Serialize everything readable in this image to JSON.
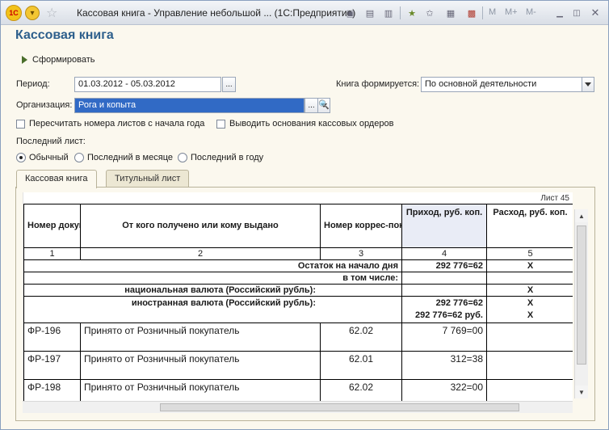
{
  "window": {
    "title": "Кассовая книга - Управление небольшой ... (1С:Предприятие)",
    "logo_text": "1C",
    "toolbar_m": [
      "M",
      "M+",
      "M-"
    ]
  },
  "page": {
    "heading": "Кассовая книга",
    "generate_label": "Сформировать"
  },
  "form": {
    "period_label": "Период:",
    "period_value": "01.03.2012 - 05.03.2012",
    "book_mode_label": "Книга формируется:",
    "book_mode_value": "По основной деятельности",
    "org_label": "Организация:",
    "org_value": "Рога и копыта",
    "recalc_label": "Пересчитать номера листов с начала года",
    "show_basis_label": "Выводить основания кассовых ордеров",
    "last_sheet_label": "Последний лист:",
    "radio_normal": "Обычный",
    "radio_month": "Последний в месяце",
    "radio_year": "Последний в году",
    "selected_radio": "Обычный"
  },
  "tabs": [
    "Кассовая книга",
    "Титульный лист"
  ],
  "sheet": {
    "page_label": "Лист 45",
    "headers": [
      "Номер документа",
      "От кого получено или кому выдано",
      "Номер коррес-пондирующего счета, субсчета",
      "Приход, руб. коп.",
      "Расход, руб. коп."
    ],
    "col_numbers": [
      "1",
      "2",
      "3",
      "4",
      "5"
    ],
    "opening_label": "Остаток на начало дня",
    "opening_income": "292 776=62",
    "opening_expense": "X",
    "including_label": "в том числе:",
    "national_label": "национальная валюта (Российский рубль):",
    "national_expense": "X",
    "foreign_label": "иностранная валюта (Российский рубль):",
    "foreign_income_1": "292 776=62",
    "foreign_income_2": "292 776=62 руб.",
    "foreign_expense_1": "X",
    "foreign_expense_2": "X",
    "rows": [
      {
        "doc": "ФР-196",
        "party": "Принято от Розничный покупатель",
        "account": "62.02",
        "income": "7 769=00",
        "expense": ""
      },
      {
        "doc": "ФР-197",
        "party": "Принято от Розничный покупатель",
        "account": "62.01",
        "income": "312=38",
        "expense": ""
      },
      {
        "doc": "ФР-198",
        "party": "Принято от Розничный покупатель",
        "account": "62.02",
        "income": "322=00",
        "expense": ""
      }
    ]
  },
  "colors": {
    "heading": "#2d5f8c",
    "selection": "#316ac5",
    "header_highlight": "#e9ecf6",
    "background": "#fbf8ee"
  }
}
